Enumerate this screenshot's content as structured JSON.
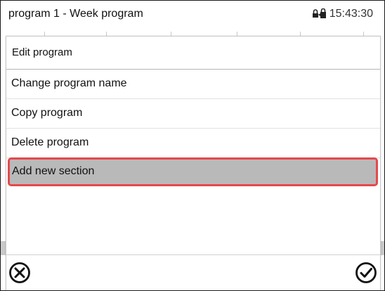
{
  "header": {
    "title": "program 1 - Week program",
    "time": "15:43:30",
    "lock_icon": "lock-icon"
  },
  "dialog": {
    "title": "Edit program",
    "items": [
      {
        "label": "Change program name",
        "selected": false
      },
      {
        "label": "Copy program",
        "selected": false
      },
      {
        "label": "Delete program",
        "selected": false
      },
      {
        "label": "Add new section",
        "selected": true
      }
    ],
    "cancel_icon": "cancel-circle-x-icon",
    "confirm_icon": "confirm-circle-check-icon"
  },
  "colors": {
    "highlight_border": "#e5484d",
    "selected_background": "#b9b9b9"
  }
}
